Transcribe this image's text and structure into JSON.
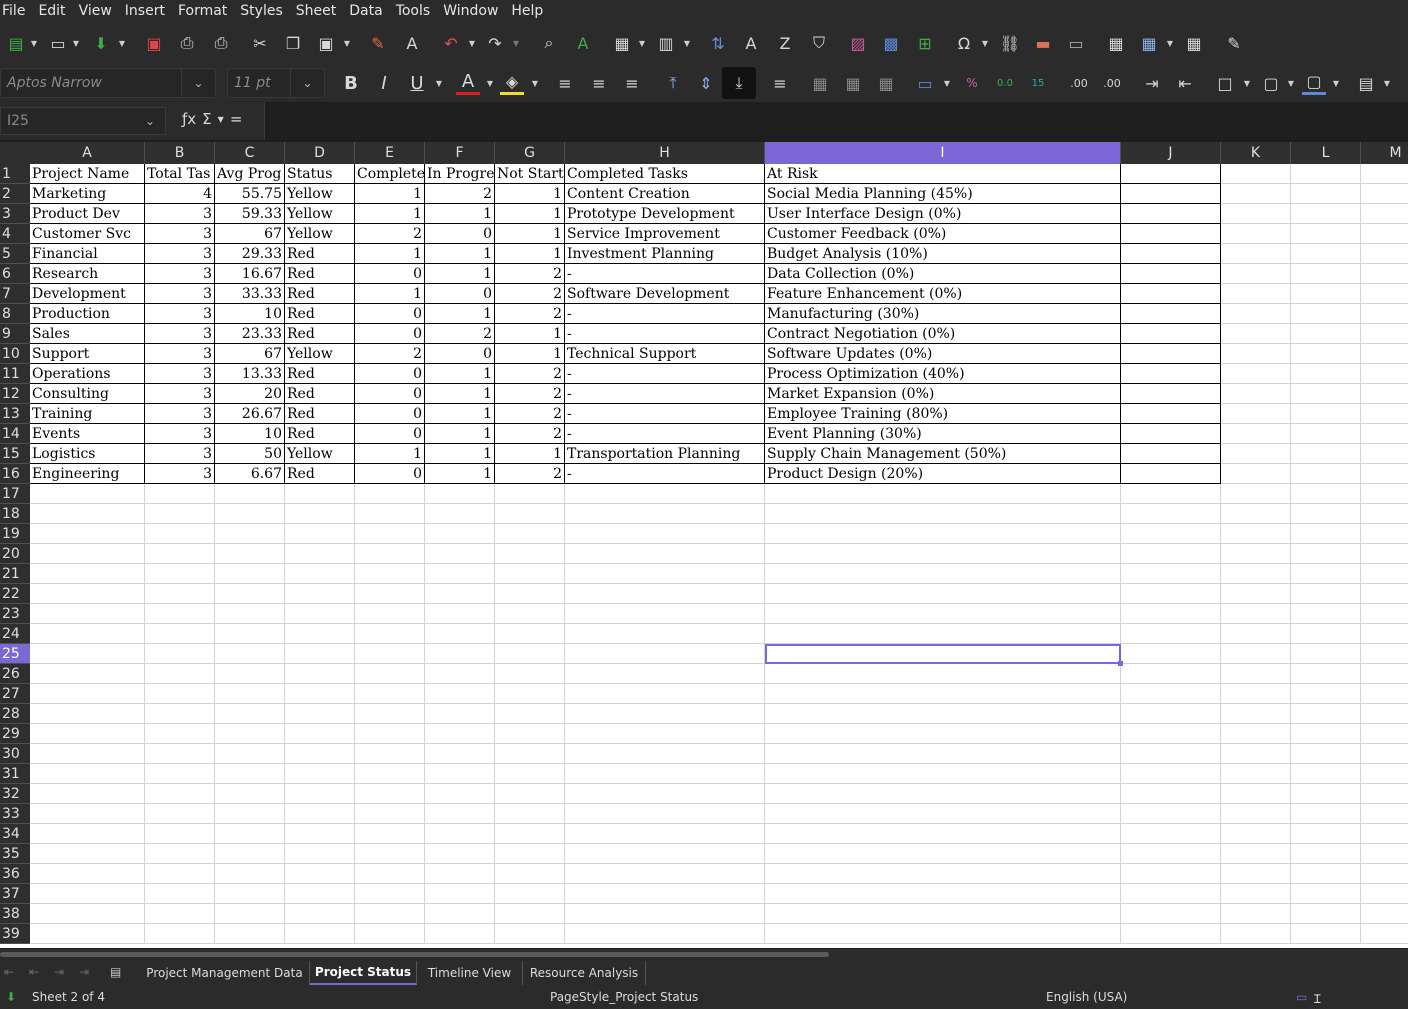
{
  "menu": [
    "File",
    "Edit",
    "View",
    "Insert",
    "Format",
    "Styles",
    "Sheet",
    "Data",
    "Tools",
    "Window",
    "Help"
  ],
  "toolbar": {
    "font_name_placeholder": "Aptos Narrow",
    "font_size_placeholder": "11 pt"
  },
  "formula_bar": {
    "cell_ref": "I25"
  },
  "columns": [
    "A",
    "B",
    "C",
    "D",
    "E",
    "F",
    "G",
    "H",
    "I",
    "J",
    "K",
    "L",
    "M"
  ],
  "rows": [
    "1",
    "2",
    "3",
    "4",
    "5",
    "6",
    "7",
    "8",
    "9",
    "10",
    "11",
    "12",
    "13",
    "14",
    "15",
    "16",
    "17",
    "18",
    "19",
    "20",
    "21",
    "22",
    "23",
    "24",
    "25",
    "26",
    "27",
    "28",
    "29",
    "30",
    "31",
    "32",
    "33",
    "34",
    "35",
    "36",
    "37",
    "38",
    "39"
  ],
  "header_row": [
    "Project Name",
    "Total Tas",
    "Avg Prog",
    "Status",
    "Complete",
    "In Progre",
    "Not Start",
    "Completed Tasks",
    "At Risk"
  ],
  "data_rows": [
    [
      "Marketing",
      "4",
      "55.75",
      "Yellow",
      "1",
      "2",
      "1",
      "Content Creation",
      "Social Media Planning (45%)"
    ],
    [
      "Product Dev",
      "3",
      "59.33",
      "Yellow",
      "1",
      "1",
      "1",
      "Prototype Development",
      "User Interface Design (0%)"
    ],
    [
      "Customer Svc",
      "3",
      "67",
      "Yellow",
      "2",
      "0",
      "1",
      "Service Improvement",
      "Customer Feedback (0%)"
    ],
    [
      "Financial",
      "3",
      "29.33",
      "Red",
      "1",
      "1",
      "1",
      "Investment Planning",
      "Budget Analysis (10%)"
    ],
    [
      "Research",
      "3",
      "16.67",
      "Red",
      "0",
      "1",
      "2",
      "-",
      "Data Collection (0%)"
    ],
    [
      "Development",
      "3",
      "33.33",
      "Red",
      "1",
      "0",
      "2",
      "Software Development",
      "Feature Enhancement (0%)"
    ],
    [
      "Production",
      "3",
      "10",
      "Red",
      "0",
      "1",
      "2",
      "-",
      "Manufacturing (30%)"
    ],
    [
      "Sales",
      "3",
      "23.33",
      "Red",
      "0",
      "2",
      "1",
      "-",
      "Contract Negotiation (0%)"
    ],
    [
      "Support",
      "3",
      "67",
      "Yellow",
      "2",
      "0",
      "1",
      "Technical Support",
      "Software Updates (0%)"
    ],
    [
      "Operations",
      "3",
      "13.33",
      "Red",
      "0",
      "1",
      "2",
      "-",
      "Process Optimization (40%)"
    ],
    [
      "Consulting",
      "3",
      "20",
      "Red",
      "0",
      "1",
      "2",
      "-",
      "Market Expansion (0%)"
    ],
    [
      "Training",
      "3",
      "26.67",
      "Red",
      "0",
      "1",
      "2",
      "-",
      "Employee Training (80%)"
    ],
    [
      "Events",
      "3",
      "10",
      "Red",
      "0",
      "1",
      "2",
      "-",
      "Event Planning (30%)"
    ],
    [
      "Logistics",
      "3",
      "50",
      "Yellow",
      "1",
      "1",
      "1",
      "Transportation Planning",
      "Supply Chain Management (50%)"
    ],
    [
      "Engineering",
      "3",
      "6.67",
      "Red",
      "0",
      "1",
      "2",
      "-",
      "Product Design (20%)"
    ]
  ],
  "sheet_tabs": [
    "Project Management Data",
    "Project Status",
    "Timeline View",
    "Resource Analysis"
  ],
  "active_tab": "Project Status",
  "status": {
    "sheet_info": "Sheet 2 of 4",
    "page_style": "PageStyle_Project Status",
    "language": "English (USA)"
  },
  "accent_color": "#7b68d6"
}
